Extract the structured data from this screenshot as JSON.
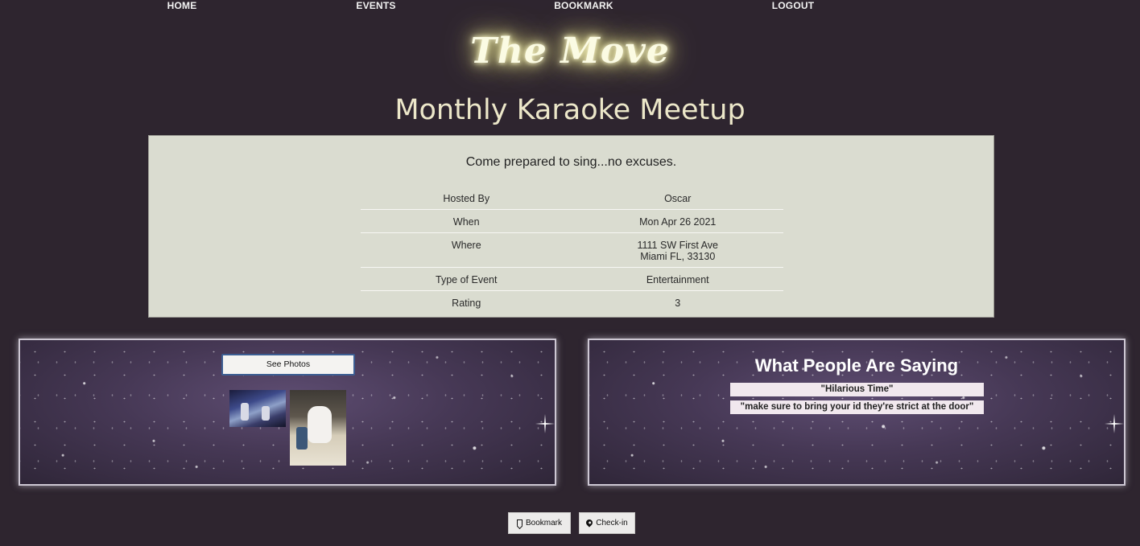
{
  "nav": {
    "items": [
      {
        "label": "HOME"
      },
      {
        "label": "EVENTS"
      },
      {
        "label": "BOOKMARK"
      },
      {
        "label": "LOGOUT"
      }
    ]
  },
  "logo": {
    "text": "The Move"
  },
  "event": {
    "title": "Monthly Karaoke Meetup",
    "description": "Come prepared to sing...no excuses.",
    "details": {
      "hosted_by": {
        "label": "Hosted By",
        "value": "Oscar"
      },
      "when": {
        "label": "When",
        "value": "Mon Apr 26 2021"
      },
      "where": {
        "label": "Where",
        "line1": "1111 SW First Ave",
        "line2": "Miami FL, 33130"
      },
      "type": {
        "label": "Type of Event",
        "value": "Entertainment"
      },
      "rating": {
        "label": "Rating",
        "value": "3"
      }
    }
  },
  "photos": {
    "button_label": "See Photos",
    "thumbnails": [
      {
        "icon": "stage-photo"
      },
      {
        "icon": "dog-photo"
      }
    ]
  },
  "reviews": {
    "title": "What People Are Saying",
    "items": [
      {
        "text": "\"Hilarious Time\""
      },
      {
        "text": "\"make sure to bring your id they're strict at the door\""
      }
    ]
  },
  "actions": {
    "bookmark": {
      "label": "Bookmark",
      "icon": "bookmark-icon"
    },
    "checkin": {
      "label": "Check-in",
      "icon": "map-pin-icon"
    }
  },
  "colors": {
    "background": "#2e252f",
    "card": "#dadcd0",
    "title": "#ece7c9",
    "logo_glow": "#fbfbe3",
    "button_border": "#3c5e93"
  }
}
